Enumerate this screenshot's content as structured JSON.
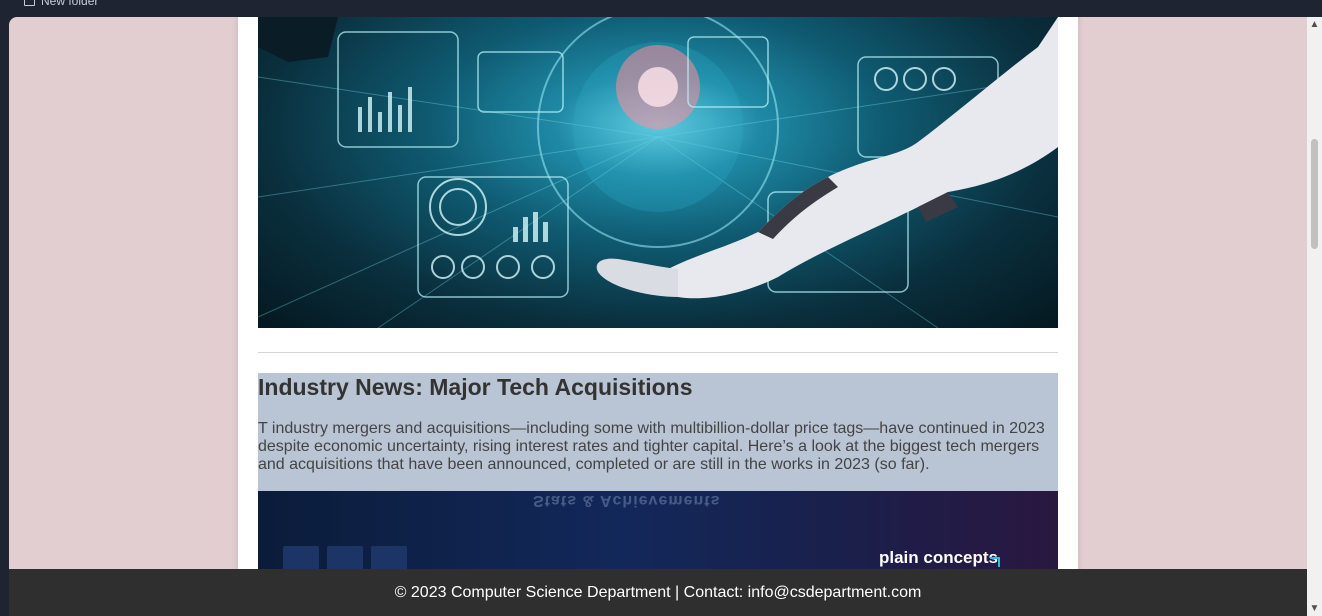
{
  "bookmarks": {
    "folder_label": "New folder"
  },
  "article": {
    "title": "Industry News: Major Tech Acquisitions",
    "body": "T industry mergers and acquisitions—including some with multibillion-dollar price tags—have continued in 2023 despite economic uncertainty, rising interest rates and tighter capital. Here’s a look at the biggest tech mergers and acquisitions that have been announced, completed or are still in the works in 2023 (so far)."
  },
  "second_image": {
    "mirrored_heading": "Stats & Achievements",
    "logo_text": "plain concepts"
  },
  "footer": {
    "text": "© 2023 Computer Science Department | Contact: info@csdepartment.com"
  },
  "colors": {
    "page_background": "#e2cdd1",
    "article_card": "#b9c4d4",
    "footer_background": "#2f2f2f",
    "browser_chrome": "#1f2433"
  }
}
